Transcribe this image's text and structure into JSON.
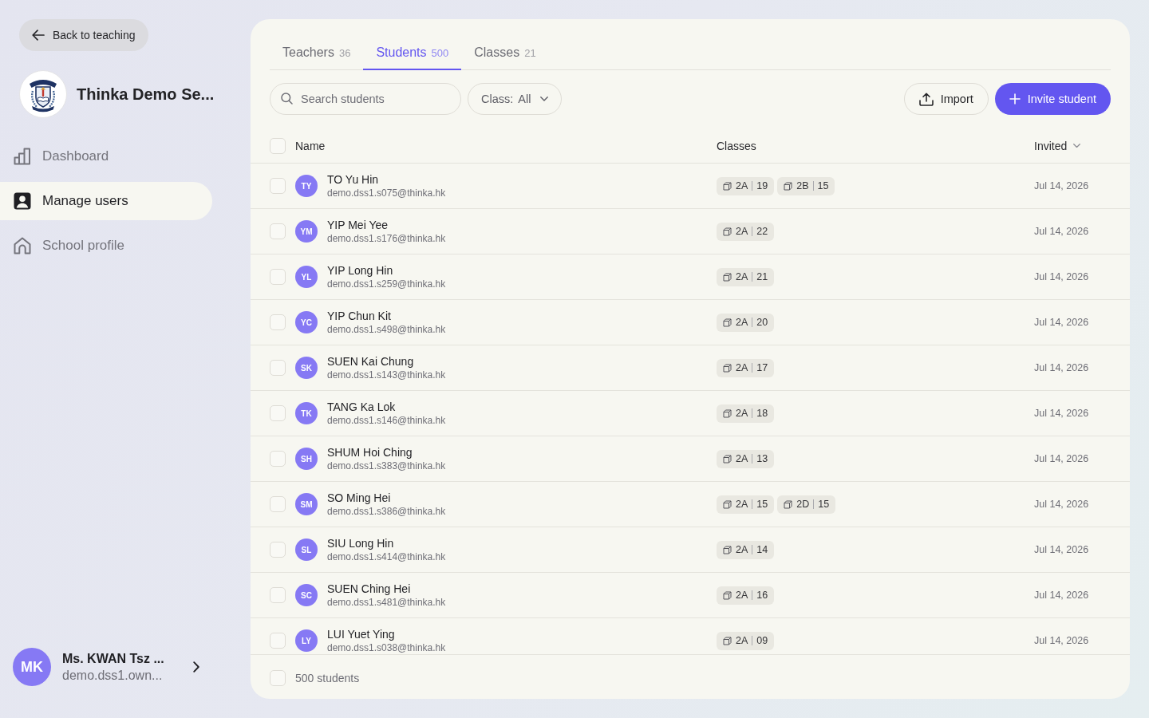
{
  "sidebar": {
    "back_button": {
      "label": "Back to teaching"
    },
    "school": {
      "name": "Thinka Demo Se..."
    },
    "nav": [
      {
        "kind": "dashboard",
        "label": "Dashboard",
        "selected": false
      },
      {
        "kind": "users",
        "label": "Manage users",
        "selected": true
      },
      {
        "kind": "school",
        "label": "School profile",
        "selected": false
      }
    ],
    "user": {
      "initials": "MK",
      "name": "Ms. KWAN Tsz ...",
      "email": "demo.dss1.own..."
    }
  },
  "tabs": [
    {
      "label": "Teachers",
      "count": "36",
      "selected": false
    },
    {
      "label": "Students",
      "count": "500",
      "selected": true
    },
    {
      "label": "Classes",
      "count": "21",
      "selected": false
    }
  ],
  "toolbar": {
    "search": {
      "placeholder": "Search students"
    },
    "class_filter": {
      "label": "Class:",
      "value": "All"
    },
    "buttons": [
      {
        "kind": "import",
        "label": "Import"
      },
      {
        "kind": "invite",
        "label": "Invite student"
      }
    ]
  },
  "table": {
    "header_checkbox": {
      "checked": false
    },
    "columns": [
      {
        "label": "Name",
        "sorted": false
      },
      {
        "label": "Classes",
        "sorted": false
      },
      {
        "label": "Invited",
        "sorted": true
      }
    ],
    "rows": [
      {
        "checked": false,
        "initials": "TY",
        "name": "TO Yu Hin",
        "email": "demo.dss1.s075@thinka.hk",
        "classes": [
          {
            "name": "2A",
            "count": "19"
          },
          {
            "name": "2B",
            "count": "15"
          }
        ],
        "invited": "Jul 14, 2026"
      },
      {
        "checked": false,
        "initials": "YM",
        "name": "YIP Mei Yee",
        "email": "demo.dss1.s176@thinka.hk",
        "classes": [
          {
            "name": "2A",
            "count": "22"
          }
        ],
        "invited": "Jul 14, 2026"
      },
      {
        "checked": false,
        "initials": "YL",
        "name": "YIP Long Hin",
        "email": "demo.dss1.s259@thinka.hk",
        "classes": [
          {
            "name": "2A",
            "count": "21"
          }
        ],
        "invited": "Jul 14, 2026"
      },
      {
        "checked": false,
        "initials": "YC",
        "name": "YIP Chun Kit",
        "email": "demo.dss1.s498@thinka.hk",
        "classes": [
          {
            "name": "2A",
            "count": "20"
          }
        ],
        "invited": "Jul 14, 2026"
      },
      {
        "checked": false,
        "initials": "SK",
        "name": "SUEN Kai Chung",
        "email": "demo.dss1.s143@thinka.hk",
        "classes": [
          {
            "name": "2A",
            "count": "17"
          }
        ],
        "invited": "Jul 14, 2026"
      },
      {
        "checked": false,
        "initials": "TK",
        "name": "TANG Ka Lok",
        "email": "demo.dss1.s146@thinka.hk",
        "classes": [
          {
            "name": "2A",
            "count": "18"
          }
        ],
        "invited": "Jul 14, 2026"
      },
      {
        "checked": false,
        "initials": "SH",
        "name": "SHUM Hoi Ching",
        "email": "demo.dss1.s383@thinka.hk",
        "classes": [
          {
            "name": "2A",
            "count": "13"
          }
        ],
        "invited": "Jul 14, 2026"
      },
      {
        "checked": false,
        "initials": "SM",
        "name": "SO Ming Hei",
        "email": "demo.dss1.s386@thinka.hk",
        "classes": [
          {
            "name": "2A",
            "count": "15"
          },
          {
            "name": "2D",
            "count": "15"
          }
        ],
        "invited": "Jul 14, 2026"
      },
      {
        "checked": false,
        "initials": "SL",
        "name": "SIU Long Hin",
        "email": "demo.dss1.s414@thinka.hk",
        "classes": [
          {
            "name": "2A",
            "count": "14"
          }
        ],
        "invited": "Jul 14, 2026"
      },
      {
        "checked": false,
        "initials": "SC",
        "name": "SUEN Ching Hei",
        "email": "demo.dss1.s481@thinka.hk",
        "classes": [
          {
            "name": "2A",
            "count": "16"
          }
        ],
        "invited": "Jul 14, 2026"
      },
      {
        "checked": false,
        "initials": "LY",
        "name": "LUI Yuet Ying",
        "email": "demo.dss1.s038@thinka.hk",
        "classes": [
          {
            "name": "2A",
            "count": "09"
          }
        ],
        "invited": "Jul 14, 2026"
      }
    ],
    "footer": {
      "label": "500 students",
      "checked": false
    }
  }
}
